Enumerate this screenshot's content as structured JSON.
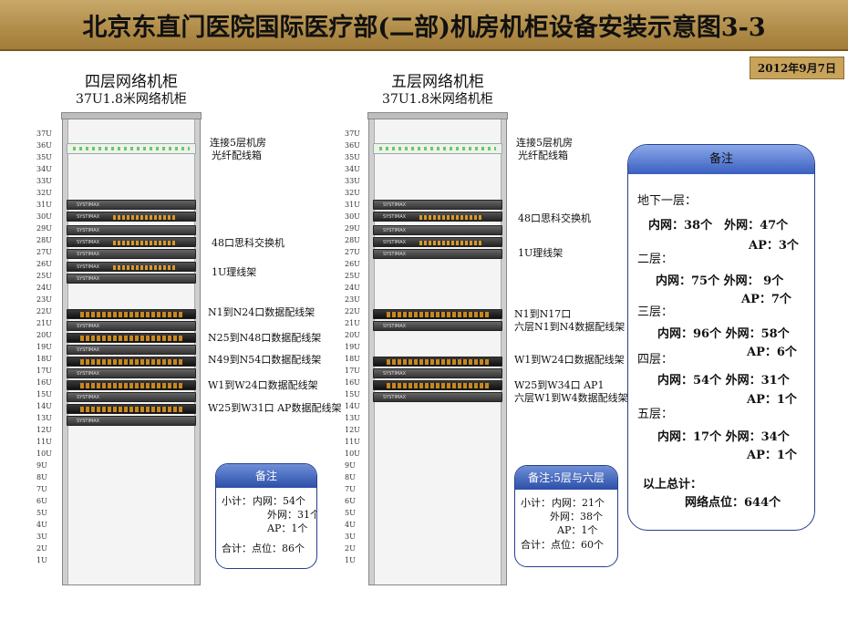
{
  "title": "北京东直门医院国际医疗部(二部)机房机柜设备安装示意图3-3",
  "date": "2012年9月7日",
  "u_labels": [
    "37U",
    "36U",
    "35U",
    "34U",
    "33U",
    "32U",
    "31U",
    "30U",
    "29U",
    "28U",
    "27U",
    "26U",
    "25U",
    "24U",
    "23U",
    "22U",
    "21U",
    "20U",
    "19U",
    "18U",
    "17U",
    "16U",
    "15U",
    "14U",
    "13U",
    "12U",
    "11U",
    "10U",
    "9U",
    "8U",
    "7U",
    "6U",
    "5U",
    "4U",
    "3U",
    "2U",
    "1U"
  ],
  "racks": {
    "left": {
      "title": "四层网络机柜",
      "subtitle": "37U1.8米网络机柜",
      "brand": "SYSTIMAX",
      "labels": {
        "fiber": "连接5层机房",
        "fiber2": "光纤配线箱",
        "switch": "48口思科交换机",
        "manager": "1U理线架",
        "p1": "N1到N24口数据配线架",
        "p2": "N25到N48口数据配线架",
        "p3": "N49到N54口数据配线架",
        "p4": "W1到W24口数据配线架",
        "p5": "W25到W31口 AP数据配线架"
      },
      "note": {
        "title": "备注",
        "subtotal_label": "小计：",
        "inner": "内网：54个",
        "outer": "外网：31个",
        "ap": "AP：1个",
        "total": "合计：点位：86个"
      }
    },
    "right": {
      "title": "五层网络机柜",
      "subtitle": "37U1.8米网络机柜",
      "brand": "SYSTIMAX",
      "labels": {
        "fiber": "连接5层机房",
        "fiber2": "光纤配线箱",
        "switch": "48口思科交换机",
        "manager": "1U理线架",
        "p1": "N1到N17口",
        "p1b": "六层N1到N4数据配线架",
        "p2": "W1到W24口数据配线架",
        "p3": "W25到W34口  AP1",
        "p3b": "六层W1到W4数据配线架"
      },
      "note": {
        "title": "备注:5层与六层",
        "subtotal_label": "小计：",
        "inner": "内网：21个",
        "outer": "外网：38个",
        "ap": "AP：1个",
        "total": "合计：点位：60个"
      }
    }
  },
  "summary": {
    "title": "备注",
    "floors": [
      {
        "name": "地下一层：",
        "line1": "内网：38个　外网：47个",
        "line2": "AP：3个"
      },
      {
        "name": "二层：",
        "line1": "内网：75个 外网：  9个",
        "line2": "AP：7个"
      },
      {
        "name": "三层：",
        "line1": "内网：96个 外网：58个",
        "line2": "AP：6个"
      },
      {
        "name": "四层：",
        "line1": "内网：54个 外网：31个",
        "line2": "AP：1个"
      },
      {
        "name": "五层：",
        "line1": "内网：17个 外网：34个",
        "line2": "AP：1个"
      }
    ],
    "total_label": "以上总计：",
    "total_value": "网络点位：644个"
  }
}
